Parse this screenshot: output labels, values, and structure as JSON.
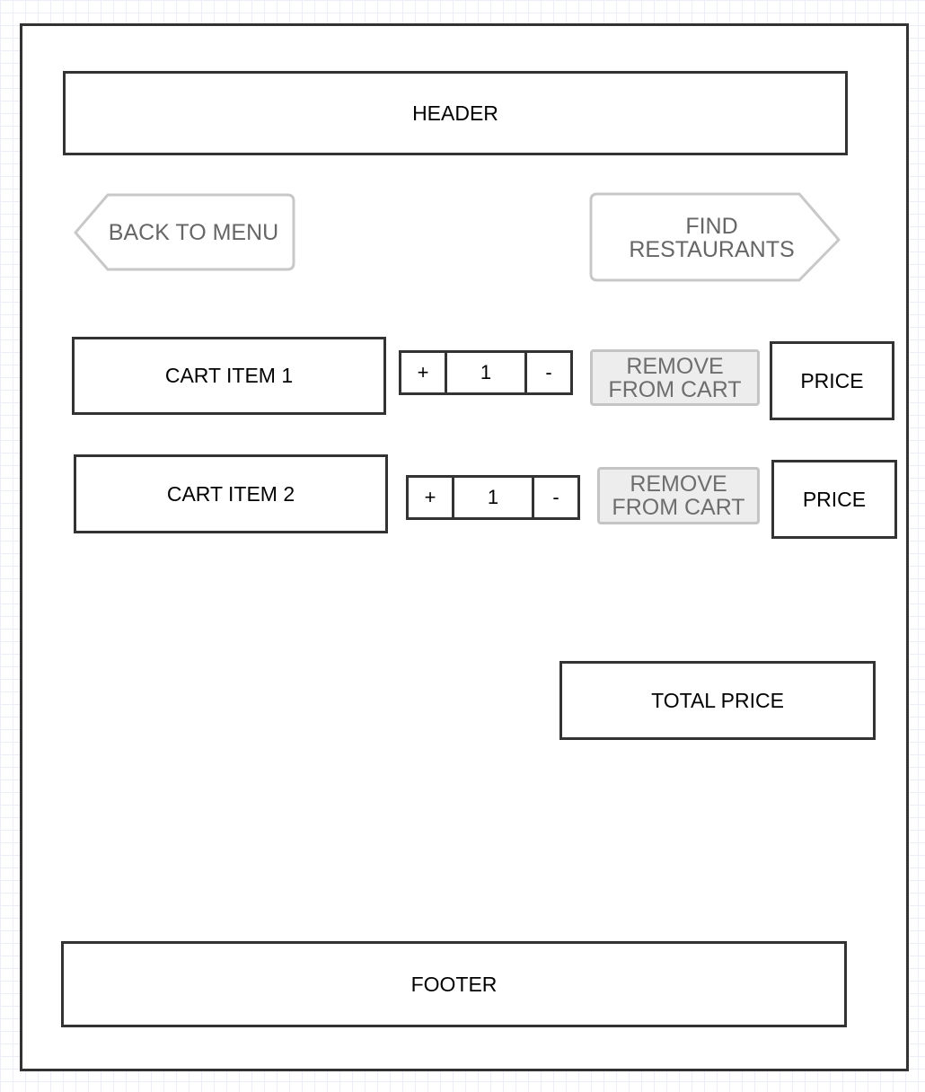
{
  "header": {
    "label": "HEADER"
  },
  "nav": {
    "back_label": "BACK TO MENU",
    "find_label_line1": "FIND",
    "find_label_line2": "RESTAURANTS"
  },
  "cart": {
    "items": [
      {
        "label": "CART ITEM 1",
        "plus": "+",
        "quantity": "1",
        "minus": "-",
        "remove_line1": "REMOVE",
        "remove_line2": "FROM CART",
        "price": "PRICE"
      },
      {
        "label": "CART ITEM 2",
        "plus": "+",
        "quantity": "1",
        "minus": "-",
        "remove_line1": "REMOVE",
        "remove_line2": "FROM CART",
        "price": "PRICE"
      }
    ],
    "total_label": "TOTAL PRICE"
  },
  "footer": {
    "label": "FOOTER"
  },
  "colors": {
    "border": "#333333",
    "nav_button_border": "#c8c8c8",
    "nav_button_text": "#666666",
    "remove_fill": "#ededed",
    "grid": "#eceef7"
  }
}
